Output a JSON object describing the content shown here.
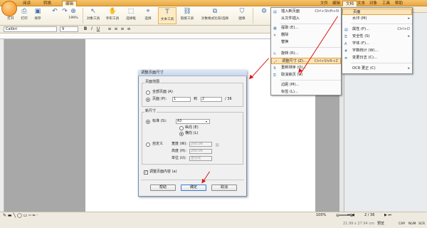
{
  "tabs": {
    "read": "阅读",
    "convert": "转换",
    "edit": "编辑"
  },
  "top_menus": {
    "file": "文件",
    "edit": "编辑",
    "doc": "文档",
    "text": "文本",
    "object": "对象",
    "tools": "工具",
    "help": "帮助"
  },
  "ribbon": [
    "打开",
    "打印",
    "保存",
    "撤销",
    "重做",
    "199%",
    "对象工具",
    "手形工具",
    "选择框",
    "选择",
    "文本工具",
    "链接工具",
    "对象格式比较/选择",
    "图章"
  ],
  "format_bar": {
    "font": "Calibri",
    "size": "9"
  },
  "doc_menu": {
    "items": [
      {
        "label": "插入新页面",
        "shortcut": "Ctrl+Shift+N"
      },
      {
        "label": "从文件插入",
        "shortcut": ""
      },
      {
        "label": "提取 (E)...",
        "shortcut": ""
      },
      {
        "label": "删除",
        "shortcut": ""
      },
      {
        "label": "替换",
        "shortcut": ""
      },
      {
        "label": "旋转 (R)...",
        "shortcut": ""
      },
      {
        "label": "调整尺寸 (Z)...",
        "shortcut": "Ctrl+Shift+Z"
      },
      {
        "label": "重新排序 (O)...",
        "shortcut": ""
      },
      {
        "label": "取消锁页 (U)",
        "shortcut": ""
      },
      {
        "label": "边距 (M)...",
        "shortcut": ""
      },
      {
        "label": "标签 (L)...",
        "shortcut": ""
      }
    ]
  },
  "sub_menu": {
    "items": [
      {
        "label": "页面",
        "shortcut": ""
      },
      {
        "label": "水印 (M)",
        "shortcut": ""
      },
      {
        "label": "属性 (P)...",
        "shortcut": "Ctrl+D"
      },
      {
        "label": "安全性 (S)",
        "shortcut": ""
      },
      {
        "label": "字体 (F)...",
        "shortcut": ""
      },
      {
        "label": "字数统计 (W)...",
        "shortcut": ""
      },
      {
        "label": "变更日志 (C)...",
        "shortcut": ""
      },
      {
        "label": "OCR 更正 (C)",
        "shortcut": ""
      }
    ]
  },
  "dialog": {
    "title": "调整页面尺寸",
    "page_range": {
      "title": "页面范围",
      "all": "全部页面 (A)",
      "pages": "页面 (P):",
      "from": "1",
      "to_label": "到",
      "to": "2",
      "total": "/ 36"
    },
    "new_size": {
      "title": "新尺寸",
      "standard": "标准 (S):",
      "standard_value": "A3",
      "portrait": "纵向 (E)",
      "landscape": "横向 (L)",
      "custom": "自定义",
      "width_label": "宽度 (W):",
      "width": "200.06",
      "height_label": "高度 (H):",
      "height": "200.06",
      "unit_label": "单位 (U):",
      "unit": "百分比"
    },
    "adjust_content": "调整页面内容 (a)",
    "buttons": {
      "help": "帮助",
      "ok": "确定",
      "cancel": "取消"
    }
  },
  "status": {
    "page": "2 / 36",
    "zoom": "100%",
    "size": "21.99 x 27.94 cm",
    "view": "预览",
    "caps": "CAP",
    "num": "NUM",
    "scrl": "SCR"
  }
}
